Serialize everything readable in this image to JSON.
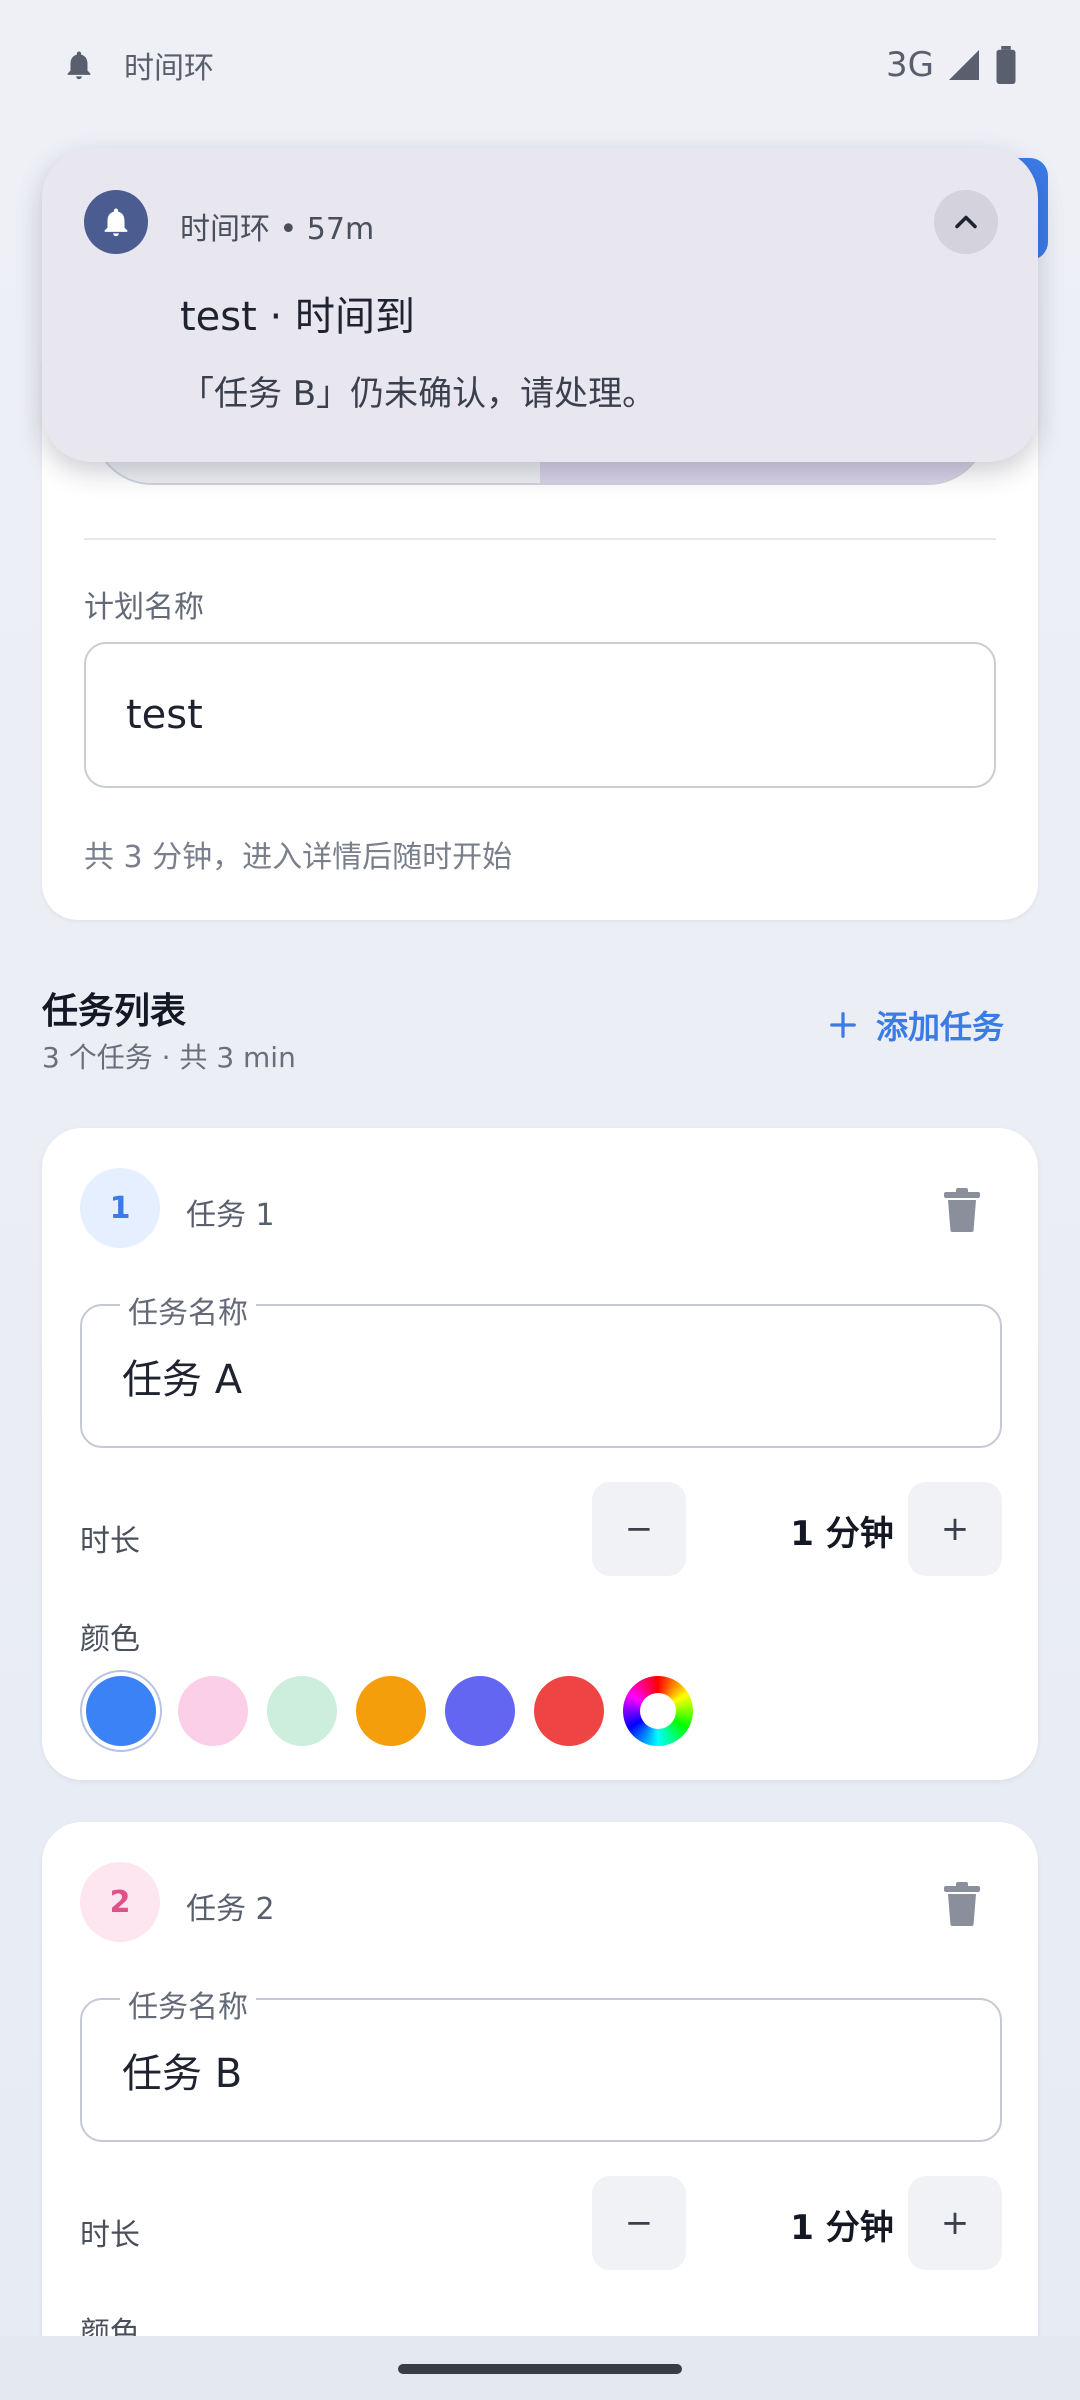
{
  "status_bar": {
    "app_name": "时间环",
    "network": "3G"
  },
  "notification": {
    "header": "时间环 • 57m",
    "title": "test · 时间到",
    "body": "「任务 B」仍未确认，请处理。"
  },
  "plan": {
    "name_label": "计划名称",
    "name_value": "test",
    "hint": "共 3 分钟，进入详情后随时开始"
  },
  "task_section": {
    "title": "任务列表",
    "subtitle": "3 个任务 · 共 3 min",
    "add_label": "添加任务"
  },
  "tasks": [
    {
      "number": "1",
      "label": "任务 1",
      "name_legend": "任务名称",
      "name_value": "任务 A",
      "duration_label": "时长",
      "duration_value": "1 分钟",
      "minus": "−",
      "plus": "+",
      "color_label": "颜色",
      "badge_bg": "#e6efff",
      "badge_fg": "#3b7be8"
    },
    {
      "number": "2",
      "label": "任务 2",
      "name_legend": "任务名称",
      "name_value": "任务 B",
      "duration_label": "时长",
      "duration_value": "1 分钟",
      "minus": "−",
      "plus": "+",
      "color_label": "颜色",
      "badge_bg": "#fde6ef",
      "badge_fg": "#e0508a"
    }
  ],
  "colors": {
    "accent": "#3b7be8",
    "swatches": [
      "#3b82f6",
      "#fbcfe8",
      "#cdeedc",
      "#f59e0b",
      "#6366f1",
      "#ef4444",
      "rainbow"
    ]
  }
}
